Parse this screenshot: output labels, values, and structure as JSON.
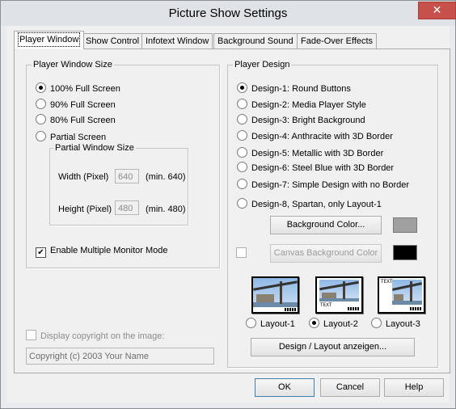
{
  "window": {
    "title": "Picture Show Settings",
    "close_glyph": "✕"
  },
  "tabs": [
    "Player Window",
    "Show Control",
    "Infotext Window",
    "Background Sound",
    "Fade-Over Effects"
  ],
  "player_window_size": {
    "title": "Player Window Size",
    "options": [
      "100% Full Screen",
      "90% Full Screen",
      "80% Full Screen",
      "Partial Screen"
    ],
    "selected": 0,
    "partial": {
      "title": "Partial Window Size",
      "width_label": "Width (Pixel)",
      "width_value": "640",
      "width_min": "(min. 640)",
      "height_label": "Height (Pixel)",
      "height_value": "480",
      "height_min": "(min. 480)"
    },
    "multi_monitor_label": "Enable Multiple Monitor Mode",
    "multi_monitor_checked": true
  },
  "copyright": {
    "checkbox_label": "Display copyright on the image:",
    "value": "Copyright (c) 2003 Your Name"
  },
  "player_design": {
    "title": "Player Design",
    "options": [
      "Design-1: Round Buttons",
      "Design-2: Media Player Style",
      "Design-3: Bright Background",
      "Design-4: Anthracite with 3D Border",
      "Design-5: Metallic with 3D Border",
      "Design-6: Steel Blue with 3D Border",
      "Design-7: Simple Design with no Border",
      "Design-8, Spartan, only Layout-1"
    ],
    "selected": 0,
    "background_color_button": "Background Color...",
    "background_color": "#a0a0a0",
    "canvas_background_button": "Canvas Background Color",
    "canvas_background_color": "#000000",
    "layouts": [
      "Layout-1",
      "Layout-2",
      "Layout-3"
    ],
    "layout_selected": 1,
    "thumb_text": "TEXT",
    "show_layout_button": "Design / Layout anzeigen..."
  },
  "footer": {
    "ok": "OK",
    "cancel": "Cancel",
    "help": "Help"
  }
}
